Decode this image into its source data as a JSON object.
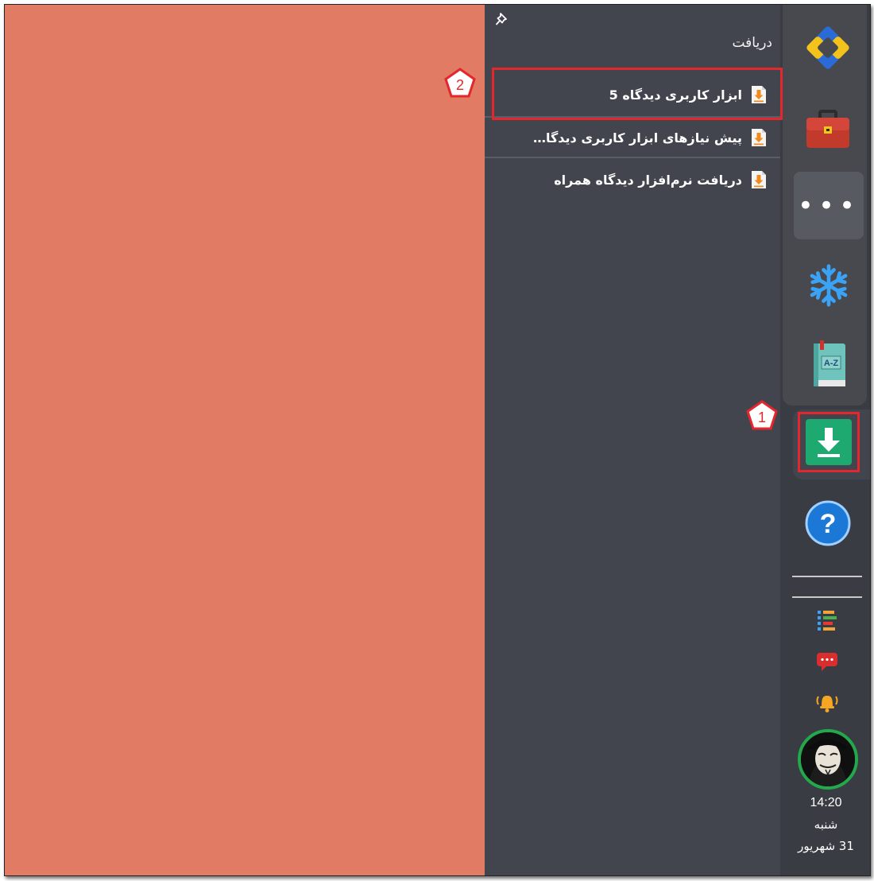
{
  "flyout": {
    "title": "دریافت",
    "items": [
      {
        "label": "ابزار کاربری دیدگاه 5",
        "icon": "download-file-icon"
      },
      {
        "label": "پیش نیازهای ابزار کاربری دیدگا…",
        "icon": "download-file-icon"
      },
      {
        "label": "دریافت نرم‌افزار دیدگاه همراه",
        "icon": "download-file-icon"
      }
    ],
    "pin_icon": "pin-icon"
  },
  "sidebar": {
    "buttons": [
      {
        "name": "logo",
        "icon": "app-logo-icon"
      },
      {
        "name": "portfolio",
        "icon": "briefcase-icon"
      },
      {
        "name": "more",
        "icon": "ellipsis-icon",
        "label": "•••"
      },
      {
        "name": "freeze",
        "icon": "snowflake-icon"
      },
      {
        "name": "dictionary",
        "icon": "book-az-icon",
        "label": "A-Z"
      },
      {
        "name": "download",
        "icon": "download-icon"
      },
      {
        "name": "help",
        "icon": "help-icon",
        "label": "?"
      }
    ],
    "tray": [
      "task-list-icon",
      "chat-icon",
      "bell-icon"
    ],
    "clock": "14:20",
    "day": "شنبه",
    "date": "31 شهریور"
  },
  "callouts": [
    "1",
    "2"
  ],
  "colors": {
    "content_bg": "#e17b63",
    "flyout_bg": "#43454e",
    "sidebar_bg": "#3a3c44",
    "highlight": "#e4262d",
    "download_green": "#1ea970"
  }
}
